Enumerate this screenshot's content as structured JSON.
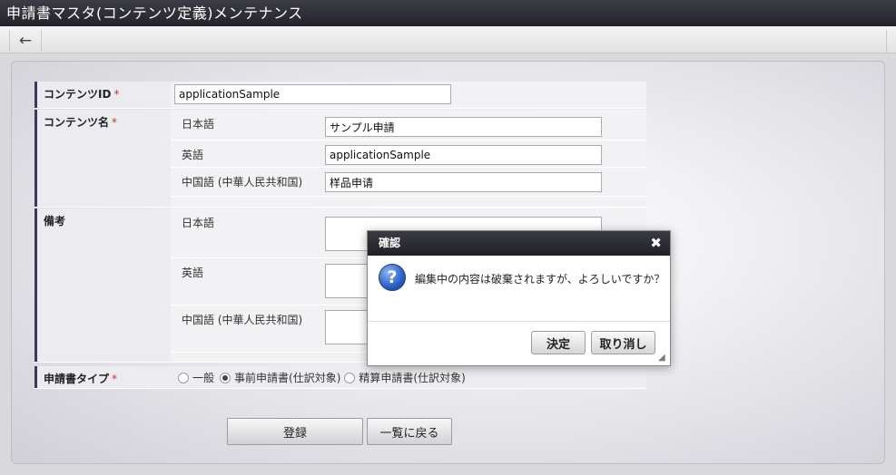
{
  "window": {
    "title": "申請書マスタ(コンテンツ定義)メンテナンス"
  },
  "toolbar": {
    "back_icon": "←"
  },
  "form": {
    "content_id": {
      "label": "コンテンツID",
      "required_mark": "*",
      "value": "applicationSample"
    },
    "content_name": {
      "label": "コンテンツ名",
      "required_mark": "*",
      "locales": [
        {
          "label": "日本語",
          "value": "サンプル申請"
        },
        {
          "label": "英語",
          "value": "applicationSample"
        },
        {
          "label": "中国語 (中華人民共和国)",
          "value": "样品申请"
        }
      ]
    },
    "remarks": {
      "label": "備考",
      "locales": [
        {
          "label": "日本語",
          "value": ""
        },
        {
          "label": "英語",
          "value": ""
        },
        {
          "label": "中国語 (中華人民共和国)",
          "value": ""
        }
      ]
    },
    "application_type": {
      "label": "申請書タイプ",
      "required_mark": "*",
      "options": [
        {
          "label": "一般",
          "checked": false
        },
        {
          "label": "事前申請書(仕訳対象)",
          "checked": true
        },
        {
          "label": "精算申請書(仕訳対象)",
          "checked": false
        }
      ]
    }
  },
  "actions": {
    "register_label": "登録",
    "back_to_list_label": "一覧に戻る"
  },
  "dialog": {
    "title": "確認",
    "close_icon": "✖",
    "question_icon": "?",
    "message": "編集中の内容は破棄されますが、よろしいですか？",
    "ok_label": "決定",
    "cancel_label": "取り消し"
  }
}
